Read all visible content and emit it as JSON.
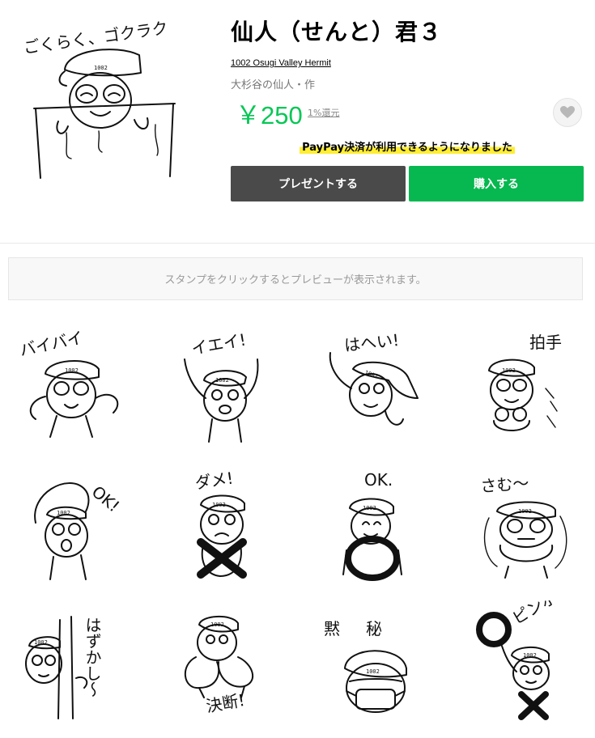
{
  "product": {
    "title": "仙人（せんと）君３",
    "author": "1002 Osugi Valley Hermit",
    "copyright": "大杉谷の仙人・作",
    "price": "￥250",
    "point_label": "1%還元",
    "main_image_caption": "ごくらく、ゴクラク"
  },
  "notice": {
    "text": "PayPay決済が利用できるようになりました"
  },
  "buttons": {
    "present_label": "プレゼントする",
    "buy_label": "購入する"
  },
  "preview": {
    "hint": "スタンプをクリックするとプレビューが表示されます。"
  },
  "stickers": [
    {
      "caption": "バイバイ",
      "icon": "waving-hermit"
    },
    {
      "caption": "イエイ!",
      "icon": "cheering-hermit"
    },
    {
      "caption": "はへい!",
      "icon": "saluting-hermit"
    },
    {
      "caption": "拍手",
      "icon": "clapping-hermit"
    },
    {
      "caption": "OK!",
      "icon": "ok-arm-hermit"
    },
    {
      "caption": "ダメ!",
      "icon": "no-cross-hermit"
    },
    {
      "caption": "OK.",
      "icon": "ok-circle-hermit"
    },
    {
      "caption": "さむ〜",
      "icon": "shivering-hermit"
    },
    {
      "caption": "はずかし〜",
      "icon": "shy-hermit"
    },
    {
      "caption": "決断!",
      "icon": "deciding-hermit"
    },
    {
      "caption": "黙秘",
      "icon": "masked-hermit"
    },
    {
      "caption": "ピンポン",
      "icon": "correct-hermit"
    }
  ],
  "colors": {
    "price_green": "#06c755",
    "buy_button": "#06b84f",
    "present_button": "#4a4a4a",
    "notice_highlight": "#ffee33"
  },
  "icons": {
    "favorite": "heart-icon"
  }
}
